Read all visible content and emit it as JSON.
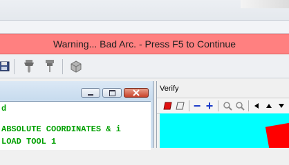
{
  "warning": {
    "message": "Warning... Bad Arc. - Press F5 to Continue"
  },
  "toolbar": {
    "icons": [
      "save-icon",
      "tool-holder-icon",
      "tool-probe-icon",
      "cycle-icon"
    ]
  },
  "left_window": {
    "code_lines": [
      "d",
      "ABSOLUTE COORDINATES & i",
      "LOAD TOOL 1"
    ],
    "buttons": [
      "minimize",
      "restore",
      "close"
    ]
  },
  "verify_window": {
    "title": "Verify",
    "toolbar_icons": [
      "solid-red-icon",
      "eraser-icon",
      "minus-icon",
      "plus-icon",
      "zoom-out-icon",
      "zoom-in-icon",
      "arrow-left-icon",
      "arrow-up-icon",
      "arrow-down-icon"
    ],
    "minus_label": "−",
    "plus_label": "+"
  },
  "colors": {
    "warning_bg": "#ff8080",
    "canvas_bg": "#00ffff",
    "code_text": "#00a000"
  }
}
